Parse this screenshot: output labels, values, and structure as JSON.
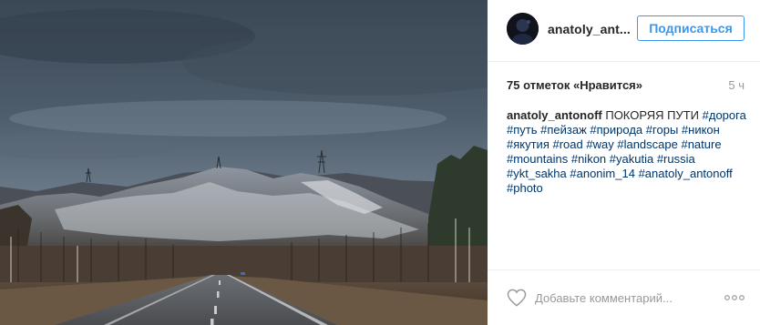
{
  "post": {
    "username": "anatoly_ant...",
    "follow_label": "Подписаться",
    "likes_text": "75 отметок «Нравится»",
    "time_text": "5 ч",
    "caption": {
      "author": "anatoly_antonoff",
      "text": " ПОКОРЯЯ ПУТИ",
      "hashtags": [
        "#дорога",
        "#путь",
        "#пейзаж",
        "#природа",
        "#горы",
        "#никон",
        "#якутия",
        "#road",
        "#way",
        "#landscape",
        "#nature",
        "#mountains",
        "#nikon",
        "#yakutia",
        "#russia",
        "#ykt_sakha",
        "#anonim_14",
        "#anatoly_antonoff",
        "#photo"
      ]
    },
    "comment_placeholder": "Добавьте комментарий...",
    "icons": {
      "like": "heart-icon",
      "more": "more-options-icon",
      "avatar": "avatar"
    },
    "colors": {
      "accent": "#3897f0",
      "hashtag": "#003569",
      "text": "#262626",
      "muted": "#999999"
    }
  }
}
